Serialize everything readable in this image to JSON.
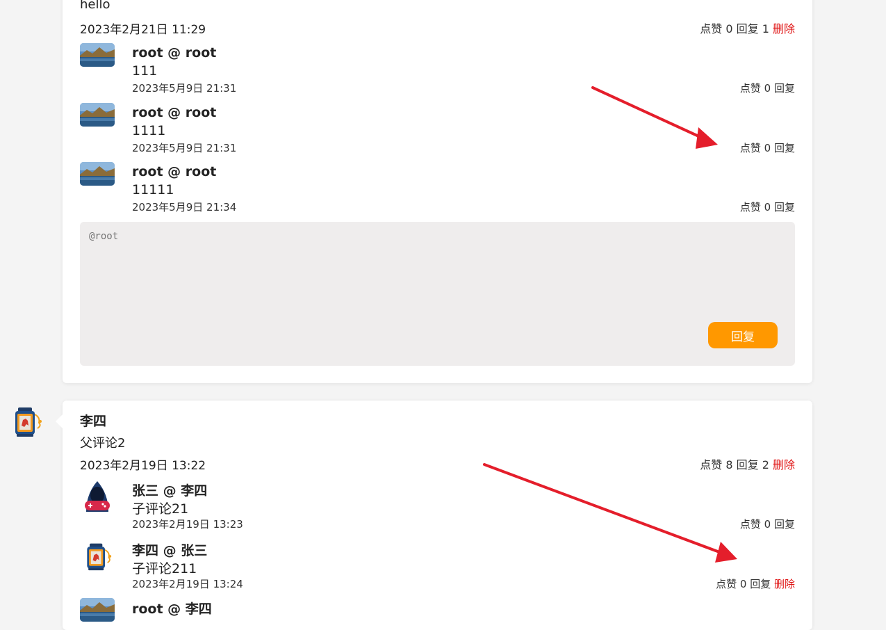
{
  "comment1": {
    "content": "hello",
    "time": "2023年2月21日 11:29",
    "like_label": "点赞",
    "likes": "0",
    "reply_label": "回复",
    "replies": "1",
    "delete_label": "删除",
    "children": [
      {
        "name": "root @ root",
        "content": "111",
        "time": "2023年5月9日 21:31",
        "like_label": "点赞",
        "likes": "0",
        "reply_label": "回复"
      },
      {
        "name": "root @ root",
        "content": "1111",
        "time": "2023年5月9日 21:31",
        "like_label": "点赞",
        "likes": "0",
        "reply_label": "回复"
      },
      {
        "name": "root @ root",
        "content": "11111",
        "time": "2023年5月9日 21:34",
        "like_label": "点赞",
        "likes": "0",
        "reply_label": "回复"
      }
    ],
    "reply_box": {
      "placeholder": "@root",
      "button_label": "回复"
    }
  },
  "comment2": {
    "author": "李四",
    "content": "父评论2",
    "time": "2023年2月19日 13:22",
    "like_label": "点赞",
    "likes": "8",
    "reply_label": "回复",
    "replies": "2",
    "delete_label": "删除",
    "children": [
      {
        "name": "张三 @ 李四",
        "content": "子评论21",
        "time": "2023年2月19日 13:23",
        "like_label": "点赞",
        "likes": "0",
        "reply_label": "回复"
      },
      {
        "name": "李四 @ 张三",
        "content": "子评论211",
        "time": "2023年2月19日 13:24",
        "like_label": "点赞",
        "likes": "0",
        "reply_label": "回复",
        "delete_label": "删除"
      },
      {
        "name": "root @ 李四"
      }
    ]
  },
  "colors": {
    "accent": "#ff9800",
    "delete": "#e01515",
    "arrow": "#e41e2b"
  },
  "icons": [
    "landscape-avatar-icon",
    "lantern-avatar-icon",
    "hacker-avatar-icon",
    "red-arrow-annotation"
  ]
}
